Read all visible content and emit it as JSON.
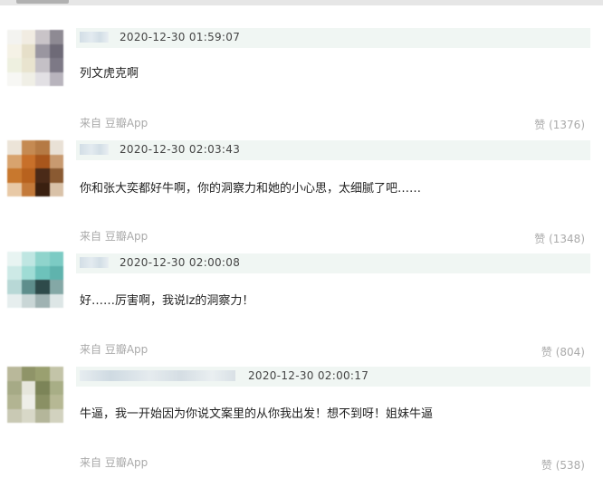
{
  "comments": [
    {
      "time": "2020-12-30 01:59:07",
      "text": "列文虎克啊",
      "source": "来自 豆瓣App",
      "likes": "赞 (1376)"
    },
    {
      "time": "2020-12-30 02:03:43",
      "text": "你和张大奕都好牛啊，你的洞察力和她的小心思，太细腻了吧……",
      "source": "来自 豆瓣App",
      "likes": "赞 (1348)"
    },
    {
      "time": "2020-12-30 02:00:08",
      "text": "好……厉害啊，我说lz的洞察力！",
      "source": "来自 豆瓣App",
      "likes": "赞 (804)"
    },
    {
      "time": "2020-12-30 02:00:17",
      "text": "牛逼，我一开始因为你说文案里的从你我出发！想不到呀！姐妹牛逼",
      "source": "来自 豆瓣App",
      "likes": "赞 (538)"
    }
  ],
  "colors": {
    "header_bg": "#f0f6f3",
    "meta_text": "#aaaaaa",
    "body_text": "#222222"
  }
}
